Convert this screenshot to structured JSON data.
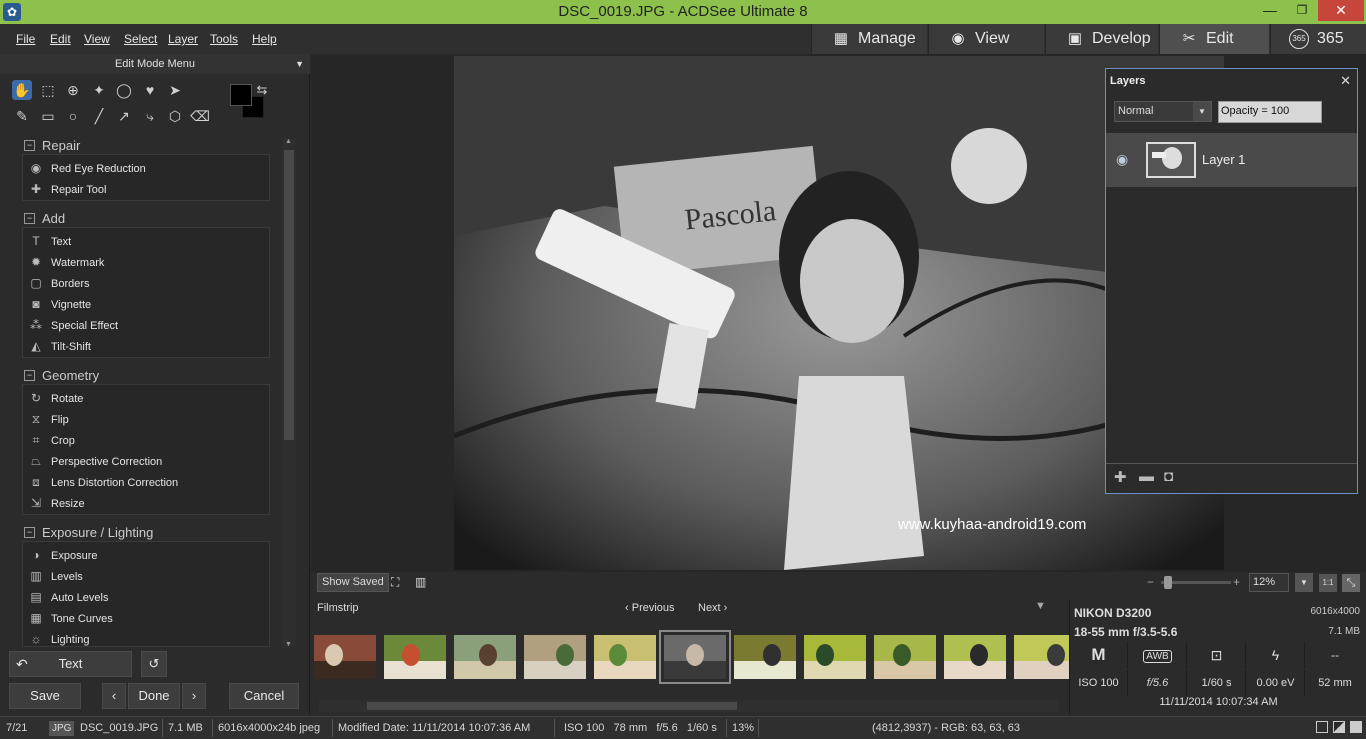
{
  "window": {
    "title": "DSC_0019.JPG - ACDSee Ultimate 8",
    "icon": "acdsee-app-icon"
  },
  "menu": [
    "File",
    "Edit",
    "View",
    "Select",
    "Layer",
    "Tools",
    "Help"
  ],
  "modes": [
    {
      "label": "Manage",
      "icon": "grid-icon"
    },
    {
      "label": "View",
      "icon": "eye-icon"
    },
    {
      "label": "Develop",
      "icon": "image-icon"
    },
    {
      "label": "Edit",
      "icon": "tools-icon",
      "active": true
    },
    {
      "label": "365",
      "icon": "365-badge-icon"
    }
  ],
  "left_panel": {
    "header": "Edit Mode Menu",
    "sections": [
      {
        "title": "Repair",
        "items": [
          {
            "label": "Red Eye Reduction",
            "icon": "eye-icon"
          },
          {
            "label": "Repair Tool",
            "icon": "bandage-icon"
          }
        ]
      },
      {
        "title": "Add",
        "items": [
          {
            "label": "Text",
            "icon": "text-icon"
          },
          {
            "label": "Watermark",
            "icon": "watermark-icon"
          },
          {
            "label": "Borders",
            "icon": "borders-icon"
          },
          {
            "label": "Vignette",
            "icon": "vignette-icon"
          },
          {
            "label": "Special Effect",
            "icon": "wand-icon"
          },
          {
            "label": "Tilt-Shift",
            "icon": "tilt-shift-icon"
          }
        ]
      },
      {
        "title": "Geometry",
        "items": [
          {
            "label": "Rotate",
            "icon": "rotate-icon"
          },
          {
            "label": "Flip",
            "icon": "flip-icon"
          },
          {
            "label": "Crop",
            "icon": "crop-icon"
          },
          {
            "label": "Perspective Correction",
            "icon": "perspective-icon"
          },
          {
            "label": "Lens Distortion Correction",
            "icon": "lens-distortion-icon"
          },
          {
            "label": "Resize",
            "icon": "resize-icon"
          }
        ]
      },
      {
        "title": "Exposure / Lighting",
        "items": [
          {
            "label": "Exposure",
            "icon": "exposure-icon"
          },
          {
            "label": "Levels",
            "icon": "levels-icon"
          },
          {
            "label": "Auto Levels",
            "icon": "auto-levels-icon"
          },
          {
            "label": "Tone Curves",
            "icon": "tone-curves-icon"
          },
          {
            "label": "Lighting",
            "icon": "lighting-icon"
          }
        ]
      }
    ],
    "history_label": "Text",
    "save": "Save",
    "done": "Done",
    "cancel": "Cancel"
  },
  "canvas": {
    "watermark": "www.kuyhaa-android19.com"
  },
  "layers": {
    "title": "Layers",
    "blend_mode": "Normal",
    "opacity": "Opacity = 100",
    "layer_name": "Layer 1"
  },
  "viewbar": {
    "show_saved": "Show Saved",
    "zoom": "12%",
    "one_to_one": "1:1"
  },
  "filmstrip": {
    "title": "Filmstrip",
    "previous": "Previous",
    "next": "Next",
    "count": 11,
    "selected_index": 5
  },
  "info": {
    "camera": "NIKON D3200",
    "lens": "18-55 mm f/3.5-5.6",
    "dimensions": "6016x4000",
    "size": "7.1 MB",
    "mode": "M",
    "wb": "AWB",
    "iso": "ISO 100",
    "aperture": "f/5.6",
    "shutter": "1/60 s",
    "ev": "0.00 eV",
    "focal": "52 mm",
    "flash": "--",
    "date": "11/11/2014 10:07:34 AM"
  },
  "status": {
    "index": "7/21",
    "type": "JPG",
    "filename": "DSC_0019.JPG",
    "filesize": "7.1 MB",
    "format": "6016x4000x24b jpeg",
    "modified": "Modified Date: 11/11/2014 10:07:36 AM",
    "exif": "ISO 100   78 mm   f/5.6   1/60 s",
    "zoom": "13%",
    "pixel": "(4812,3937) - RGB: 63, 63, 63"
  },
  "colors": {
    "titlebar": "#8dc14b",
    "close": "#c7463c",
    "accent": "#3d6aa8"
  }
}
